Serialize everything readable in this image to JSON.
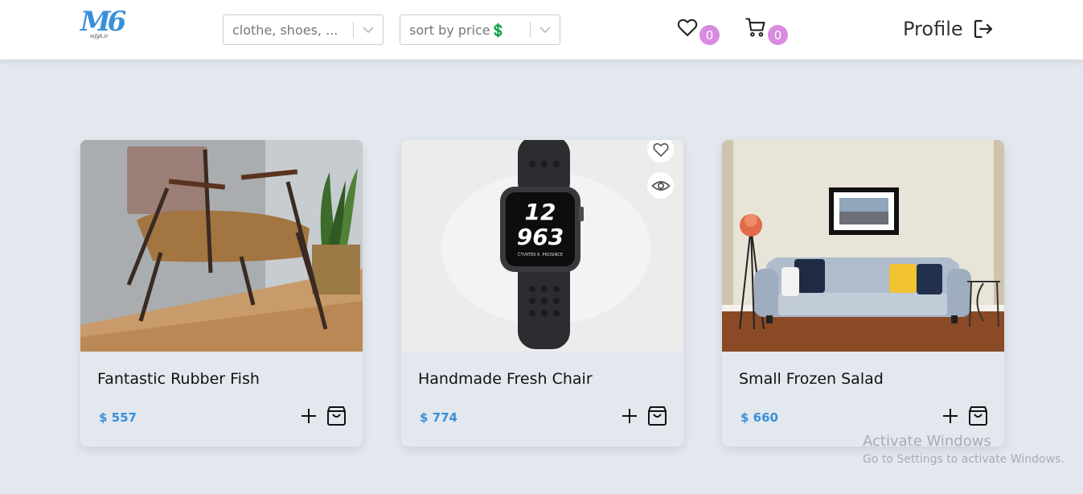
{
  "header": {
    "logo": {
      "mark": "M6",
      "sub": "mfgh.ir"
    },
    "category_select": {
      "value": "clothe, shoes, ..."
    },
    "sort_select": {
      "value": "sort by price",
      "symbol": "💲"
    },
    "wishlist": {
      "icon": "heart-icon",
      "count": "0"
    },
    "cart": {
      "icon": "cart-icon",
      "count": "0"
    },
    "profile": {
      "label": "Profile",
      "icon": "logout-icon"
    }
  },
  "products": [
    {
      "title": "Fantastic Rubber Fish",
      "price": "$ 557",
      "image": "armchair-photo"
    },
    {
      "title": "Handmade Fresh Chair",
      "price": "$ 774",
      "image": "smartwatch-photo"
    },
    {
      "title": "Small Frozen Salad",
      "price": "$ 660",
      "image": "sofa-room-photo"
    }
  ],
  "watch_face": {
    "hours_top": "12",
    "hours_bottom": "963",
    "date": "ČTVRTEK 6. PROSINCE"
  },
  "watermark": {
    "title": "Activate Windows",
    "subtitle": "Go to Settings to activate Windows."
  },
  "colors": {
    "accent": "#3a8fd9",
    "badge": "#d88be0",
    "background": "#e2e8ee"
  }
}
